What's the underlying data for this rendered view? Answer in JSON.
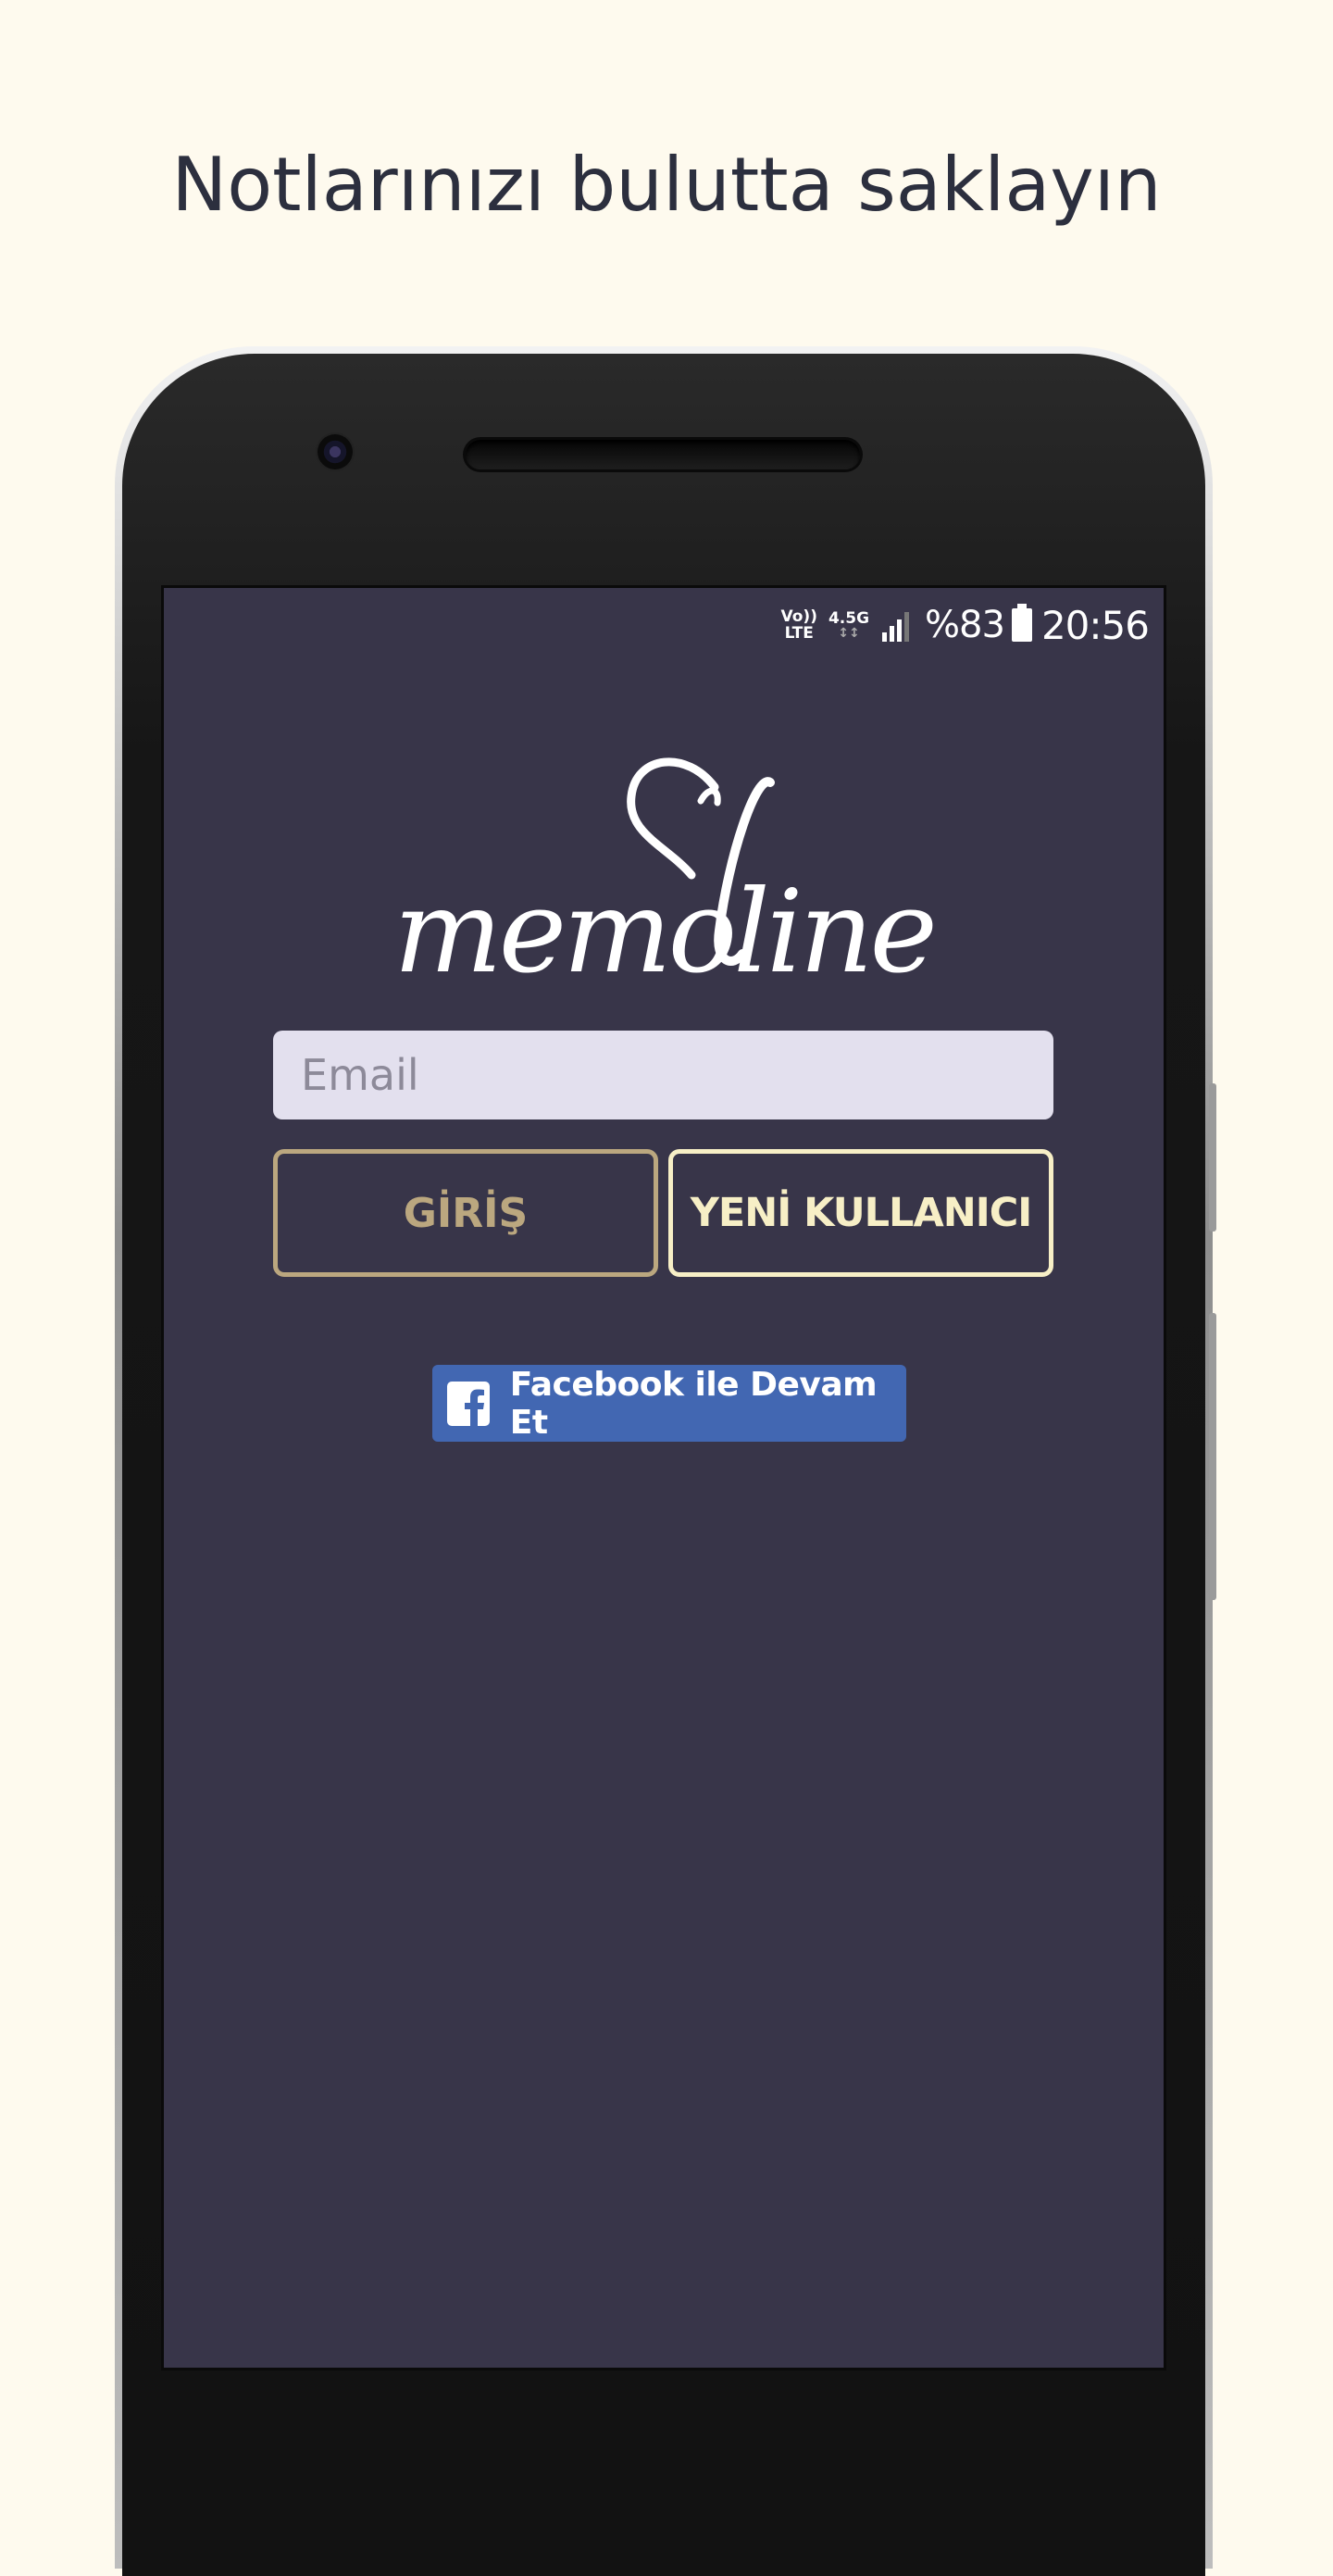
{
  "headline": "Notlarınızı bulutta saklayın",
  "status_bar": {
    "volte_top": "Vo))",
    "volte_bottom": "LTE",
    "network": "4.5G",
    "battery_percent": "%83",
    "time": "20:56",
    "icons": [
      "volte-icon",
      "network-4-5g-icon",
      "signal-icon",
      "battery-icon"
    ]
  },
  "app": {
    "logo_text": "memoline",
    "email": {
      "placeholder": "Email",
      "value": ""
    },
    "login_button": "GİRİŞ",
    "new_user_button": "YENİ KULLANICI",
    "facebook_button": "Facebook ile Devam Et"
  },
  "colors": {
    "page_background": "#fefaee",
    "screen_background": "#383549",
    "login_accent": "#bba77f",
    "new_user_accent": "#f7efc6",
    "facebook_blue": "#4267b2",
    "email_field_bg": "#e3e0ee",
    "headline_text": "#2c2f3e"
  }
}
